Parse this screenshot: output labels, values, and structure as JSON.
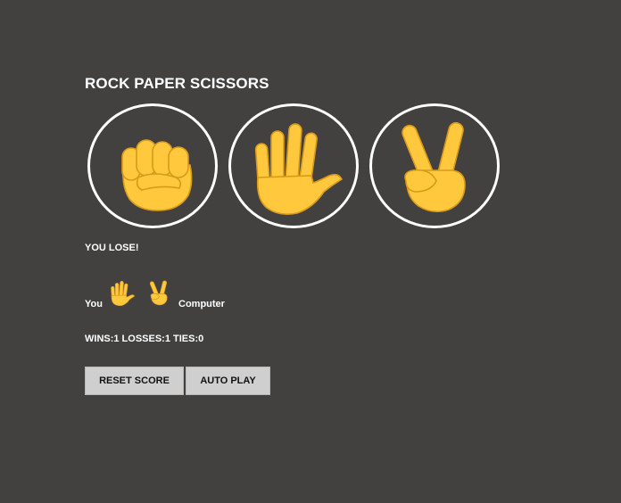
{
  "game": {
    "title": "ROCK PAPER SCISSORS",
    "moves": [
      {
        "name": "rock",
        "icon": "raised-fist-icon"
      },
      {
        "name": "paper",
        "icon": "raised-hand-icon"
      },
      {
        "name": "scissors",
        "icon": "victory-hand-icon"
      }
    ],
    "result": "YOU LOSE!",
    "you_label": "You",
    "computer_label": "Computer",
    "you_pick_icon": "raised-hand-icon",
    "computer_pick_icon": "victory-hand-icon",
    "score": "WINS:1 LOSSES:1 TIES:0",
    "reset_label": "RESET SCORE",
    "auto_label": "AUTO PLAY"
  },
  "colors": {
    "background": "#424140",
    "emoji": "#FFC83D",
    "emoji_outline": "#D99A1A",
    "button": "#CFCFCF"
  }
}
